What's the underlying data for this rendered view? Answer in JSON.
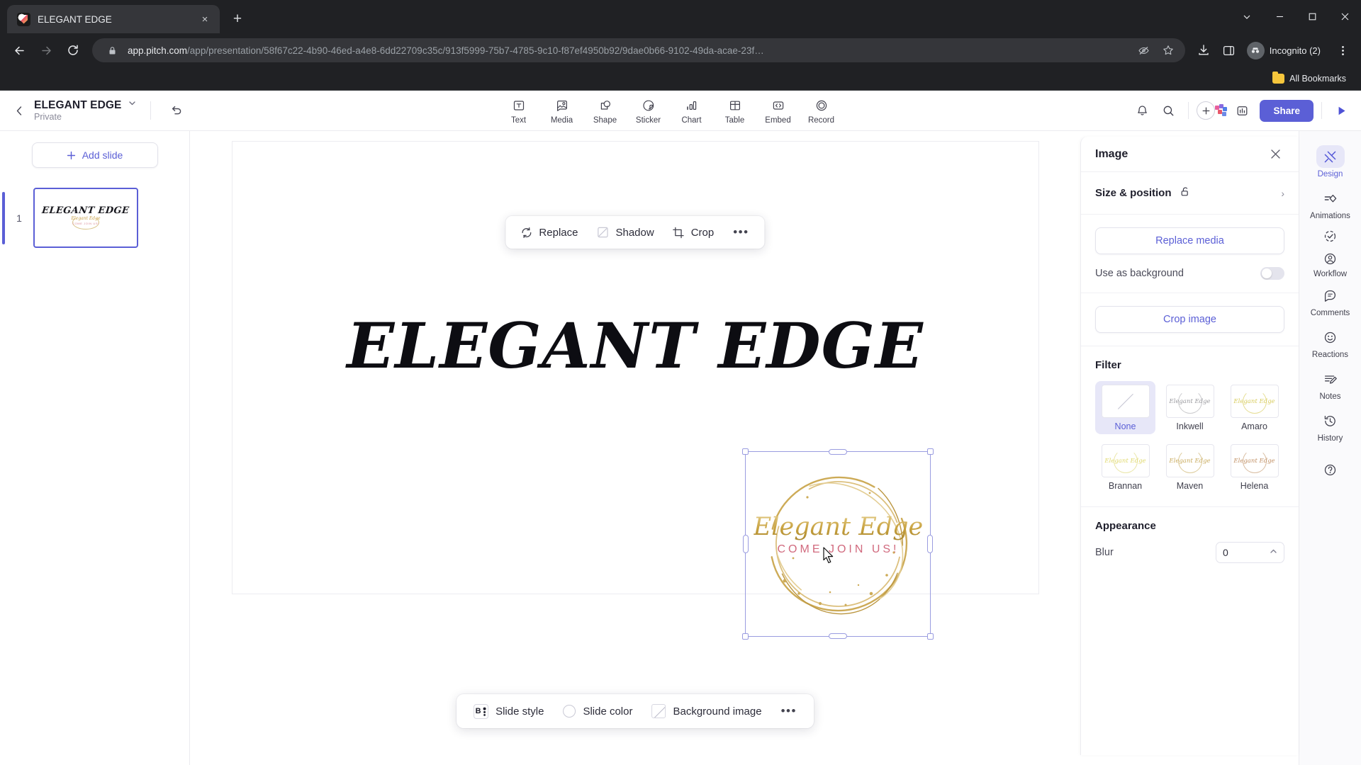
{
  "browser": {
    "tab": {
      "title": "ELEGANT EDGE",
      "favicon": "pitch-logo-icon",
      "close": "×"
    },
    "new_tab": "+",
    "window_controls": {
      "minimize": "—",
      "maximize": "□",
      "close": "✕",
      "chevron": "⌄"
    },
    "nav": {
      "back": "←",
      "forward": "→",
      "reload": "⟳"
    },
    "omnibox": {
      "lock": "lock-icon",
      "url_host": "app.pitch.com",
      "url_path": "/app/presentation/58f67c22-4b90-46ed-a4e8-6dd22709c35c/913f5999-75b7-4785-9c10-f87ef4950b92/9dae0b66-9102-49da-acae-23f…"
    },
    "profile": {
      "label": "Incognito (2)"
    },
    "bookmarks": {
      "all_bookmarks": "All Bookmarks"
    }
  },
  "app_header": {
    "deck_title": "ELEGANT EDGE",
    "deck_visibility": "Private",
    "tools": [
      {
        "label": "Text",
        "icon": "text-icon"
      },
      {
        "label": "Media",
        "icon": "media-icon"
      },
      {
        "label": "Shape",
        "icon": "shape-icon"
      },
      {
        "label": "Sticker",
        "icon": "sticker-icon"
      },
      {
        "label": "Chart",
        "icon": "chart-icon"
      },
      {
        "label": "Table",
        "icon": "table-icon"
      },
      {
        "label": "Embed",
        "icon": "embed-icon"
      },
      {
        "label": "Record",
        "icon": "record-icon"
      }
    ],
    "share_label": "Share"
  },
  "slides_panel": {
    "add_slide": "Add slide",
    "slides": [
      {
        "number": "1",
        "title": "ELEGANT EDGE",
        "script": "Elegant Edge",
        "tagline": "COME JOIN US!"
      }
    ]
  },
  "canvas": {
    "wordmark": "ELEGANT EDGE",
    "image": {
      "script": "Elegant Edge",
      "tagline": "COME JOIN US!"
    },
    "image_toolbar": {
      "replace": "Replace",
      "shadow": "Shadow",
      "crop": "Crop",
      "more": "•••"
    },
    "slide_toolbar": {
      "slide_style": "Slide style",
      "slide_color": "Slide color",
      "background_image": "Background image",
      "more": "•••"
    }
  },
  "properties": {
    "title": "Image",
    "close": "✕",
    "size_position": "Size & position",
    "size_position_chevron": "›",
    "replace_media": "Replace media",
    "use_as_background": "Use as background",
    "use_as_background_on": false,
    "crop_image": "Crop image",
    "filter_heading": "Filter",
    "filters": [
      {
        "label": "None",
        "active": true
      },
      {
        "label": "Inkwell",
        "active": false
      },
      {
        "label": "Amaro",
        "active": false
      },
      {
        "label": "Brannan",
        "active": false
      },
      {
        "label": "Maven",
        "active": false
      },
      {
        "label": "Helena",
        "active": false
      }
    ],
    "appearance_heading": "Appearance",
    "blur_label": "Blur",
    "blur_value": "0"
  },
  "rail": {
    "items": [
      {
        "label": "Design",
        "icon": "design-icon",
        "active": true
      },
      {
        "label": "Animations",
        "icon": "animations-icon",
        "active": false
      },
      {
        "label": "Workflow",
        "icon": "workflow-icon",
        "active": false
      },
      {
        "label": "Comments",
        "icon": "comments-icon",
        "active": false
      },
      {
        "label": "Reactions",
        "icon": "reactions-icon",
        "active": false
      },
      {
        "label": "Notes",
        "icon": "notes-icon",
        "active": false
      },
      {
        "label": "History",
        "icon": "history-icon",
        "active": false
      }
    ],
    "help": "?"
  },
  "colors": {
    "accent": "#5b5fd6",
    "chrome_bg": "#202124",
    "gold": "#c8a23f",
    "pink": "#d16a7e"
  }
}
